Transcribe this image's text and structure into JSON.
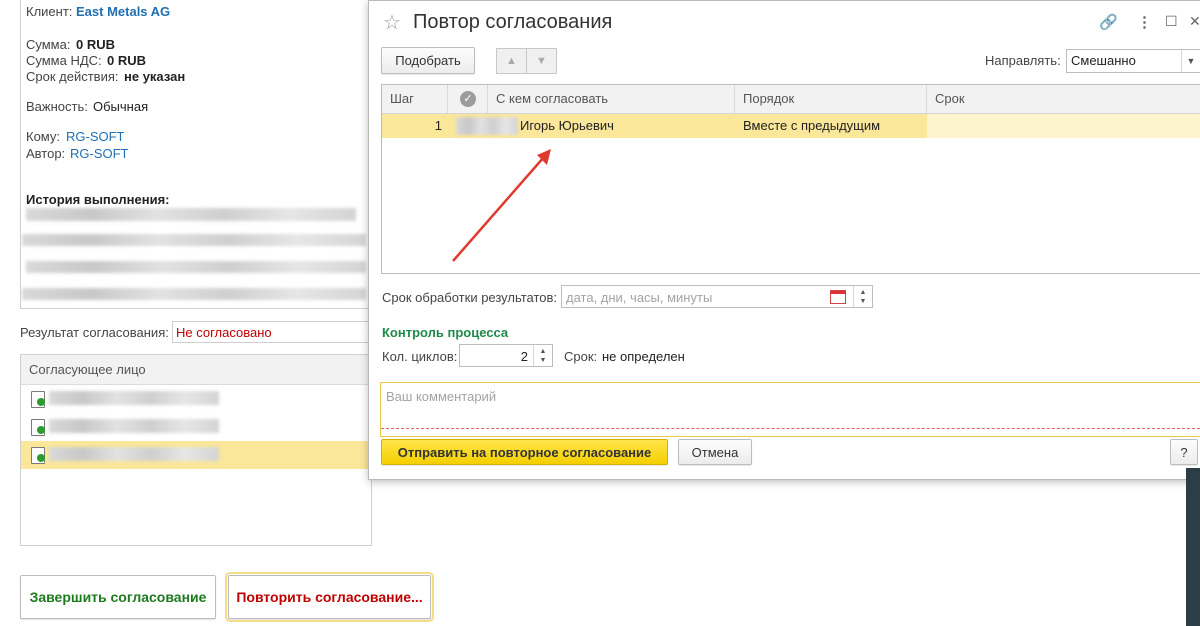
{
  "background_form": {
    "client_label": "Клиент:",
    "client_value": "East Metals AG",
    "sum_label": "Сумма:",
    "sum_value": "0 RUB",
    "vat_label": "Сумма НДС:",
    "vat_value": "0 RUB",
    "term_label": "Срок действия:",
    "term_value": "не указан",
    "importance_label": "Важность:",
    "importance_value": "Обычная",
    "to_label": "Кому:",
    "to_value": "RG-SOFT",
    "author_label": "Автор:",
    "author_value": "RG-SOFT",
    "history_title": "История выполнения:",
    "result_label": "Результат согласования:",
    "result_value": "Не согласовано",
    "approvers_header": "Согласующее лицо",
    "btn_finish": "Завершить согласование",
    "btn_repeat": "Повторить согласование..."
  },
  "modal": {
    "title": "Повтор согласования",
    "btn_pick": "Подобрать",
    "direct_label": "Направлять:",
    "direct_value": "Смешанно",
    "columns": [
      "Шаг",
      "С кем согласовать",
      "Порядок",
      "Срок"
    ],
    "rows": [
      {
        "step": "1",
        "who": "Игорь Юрьевич",
        "order": "Вместе с предыдущим",
        "term": ""
      }
    ],
    "processing_label": "Срок обработки результатов:",
    "processing_placeholder": "дата, дни, часы, минуты",
    "control_title": "Контроль процесса",
    "cycles_label": "Кол. циклов:",
    "cycles_value": "2",
    "deadline_label": "Срок:",
    "deadline_value": "не определен",
    "comment_placeholder": "Ваш комментарий",
    "btn_send": "Отправить на повторное согласование",
    "btn_cancel": "Отмена",
    "btn_help": "?"
  },
  "colors": {
    "selected_row": "#fbe79a",
    "primary_button": "#f5cf00",
    "link": "#1f6fb2",
    "red": "#c00000",
    "green": "#1e8a4a"
  }
}
